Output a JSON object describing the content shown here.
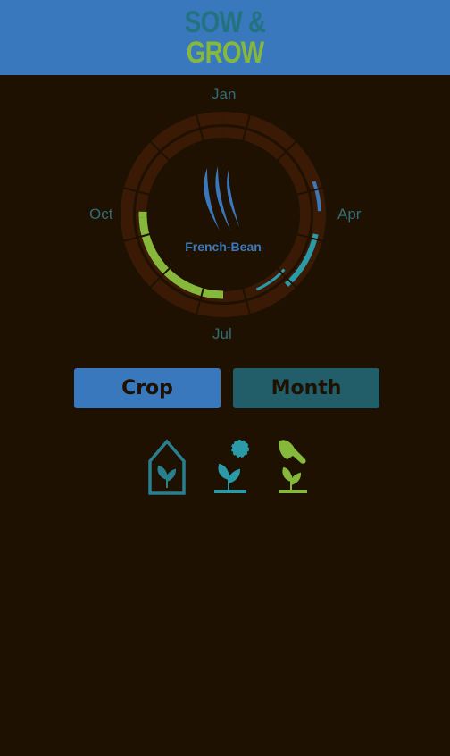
{
  "app": {
    "title_line1": "SOW &",
    "title_line2": "GROW"
  },
  "wheel": {
    "months": {
      "top": "Jan",
      "right": "Apr",
      "bottom": "Jul",
      "left": "Oct"
    },
    "crop_name": "French-Bean",
    "colors": {
      "indoor": "#3a78bd",
      "outdoor": "#2a9aa8",
      "harvest": "#86b83c",
      "empty": "#3a1a05"
    }
  },
  "buttons": {
    "crop_label": "Crop",
    "month_label": "Month"
  },
  "legend": {
    "items": [
      {
        "icon": "greenhouse-seedling-icon",
        "color": "#2a7f8f"
      },
      {
        "icon": "sun-seedling-icon",
        "color": "#2a9aa8"
      },
      {
        "icon": "hand-harvest-icon",
        "color": "#86b83c"
      }
    ]
  }
}
